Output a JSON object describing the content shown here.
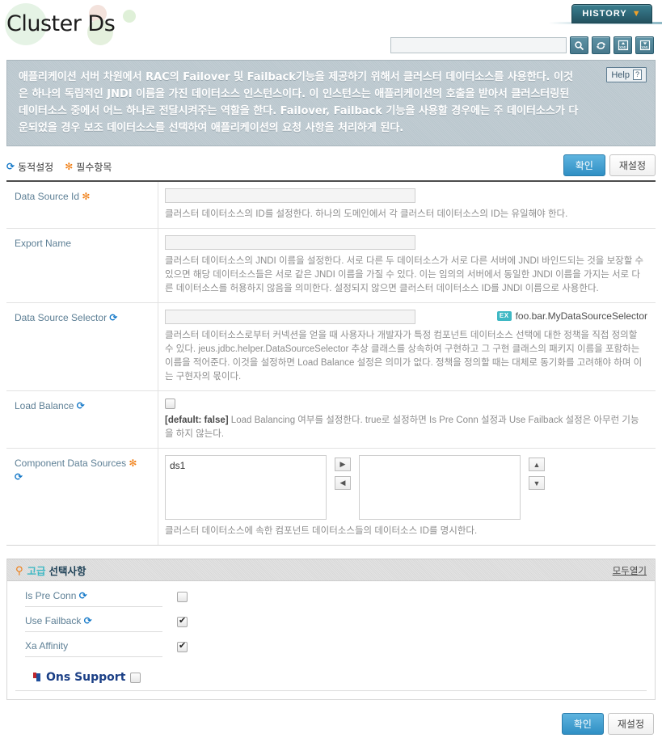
{
  "header": {
    "title": "Cluster Ds",
    "history_label": "HISTORY",
    "history_chevron": "▼",
    "search_value": "",
    "search_placeholder": "",
    "tools": [
      {
        "name": "search-icon",
        "title": "Search"
      },
      {
        "name": "refresh-icon",
        "title": "Refresh"
      },
      {
        "name": "xml-import-icon",
        "title": "XML Import"
      },
      {
        "name": "xml-export-icon",
        "title": "XML Export"
      }
    ]
  },
  "description": {
    "text": "애플리케이션 서버 차원에서 RAC의 Failover 및 Failback기능을 제공하기 위해서 클러스터 데이터소스를 사용한다. 이것은 하나의 독립적인 JNDI 이름을 가진 데이터소스 인스턴스이다. 이 인스턴스는 애플리케이션의 호출을 받아서 클러스터링된 데이터소스 중에서 어느 하나로 전달시켜주는 역할을 한다. Failover, Failback 기능을 사용할 경우에는 주 데이터소스가 다운되었을 경우 보조 데이터소스를 선택하여 애플리케이션의 요청 사항을 처리하게 된다.",
    "help_label": "Help",
    "help_icon": "?"
  },
  "legend": {
    "dynamic_icon": "⟳",
    "dynamic_label": "동적설정",
    "required_icon": "✻",
    "required_label": "필수항목"
  },
  "actions": {
    "confirm_label": "확인",
    "reset_label": "재설정"
  },
  "form": {
    "rows": [
      {
        "label": "Data Source Id",
        "required": true,
        "dynamic": false,
        "value": "",
        "desc": "클러스터 데이터소스의 ID를 설정한다. 하나의 도메인에서 각 클러스터 데이터소스의 ID는 유일해야 한다."
      },
      {
        "label": "Export Name",
        "required": false,
        "dynamic": false,
        "value": "",
        "desc": "클러스터 데이터소스의 JNDI 이름을 설정한다. 서로 다른 두 데이터소스가 서로 다른 서버에 JNDI 바인드되는 것을 보장할 수 있으면 해당 데이터소스들은 서로 같은 JNDI 이름을 가질 수 있다. 이는 임의의 서버에서 동일한 JNDI 이름을 가지는 서로 다른 데이터소스를 허용하지 않음을 의미한다. 설정되지 않으면 클러스터 데이터소스 ID를 JNDI 이름으로 사용한다."
      },
      {
        "label": "Data Source Selector",
        "required": false,
        "dynamic": true,
        "value": "",
        "example_badge": "EX",
        "example_text": "foo.bar.MyDataSourceSelector",
        "desc": "클러스터 데이터소스로부터 커넥션을 얻을 때 사용자나 개발자가 특정 컴포넌트 데이터소스 선택에 대한 정책을 직접 정의할 수 있다. jeus.jdbc.helper.DataSourceSelector 추상 클래스를 상속하여 구현하고 그 구현 클래스의 패키지 이름을 포함하는 이름을 적어준다. 이것을 설정하면 Load Balance 설정은 의미가 없다. 정책을 정의할 때는 대체로 동기화를 고려해야 하며 이는 구현자의 몫이다."
      },
      {
        "label": "Load Balance",
        "required": false,
        "dynamic": true,
        "checked": false,
        "default_note": "[default: false]",
        "desc": "Load Balancing 여부를 설정한다. true로 설정하면 Is Pre Conn 설정과 Use Failback 설정은 아무런 기능을 하지 않는다."
      },
      {
        "label": "Component Data Sources",
        "required": true,
        "dynamic": true,
        "desc": "클러스터 데이터소스에 속한 컴포넌트 데이터소스들의 데이터소스 ID를 명시한다.",
        "available_items": [
          "ds1"
        ],
        "selected_items": [],
        "move_right": "▶",
        "move_left": "◀",
        "move_up": "▲",
        "move_down": "▼"
      }
    ]
  },
  "advanced": {
    "pin_icon": "⚲",
    "keyword": "고급",
    "title": "선택사항",
    "expand_all": "모두열기",
    "rows": [
      {
        "label": "Is Pre Conn",
        "dynamic": true,
        "checked": false
      },
      {
        "label": "Use Failback",
        "dynamic": true,
        "checked": true
      },
      {
        "label": "Xa Affinity",
        "dynamic": false,
        "checked": true
      }
    ],
    "group": {
      "label": "Ons Support",
      "checked": false
    }
  }
}
